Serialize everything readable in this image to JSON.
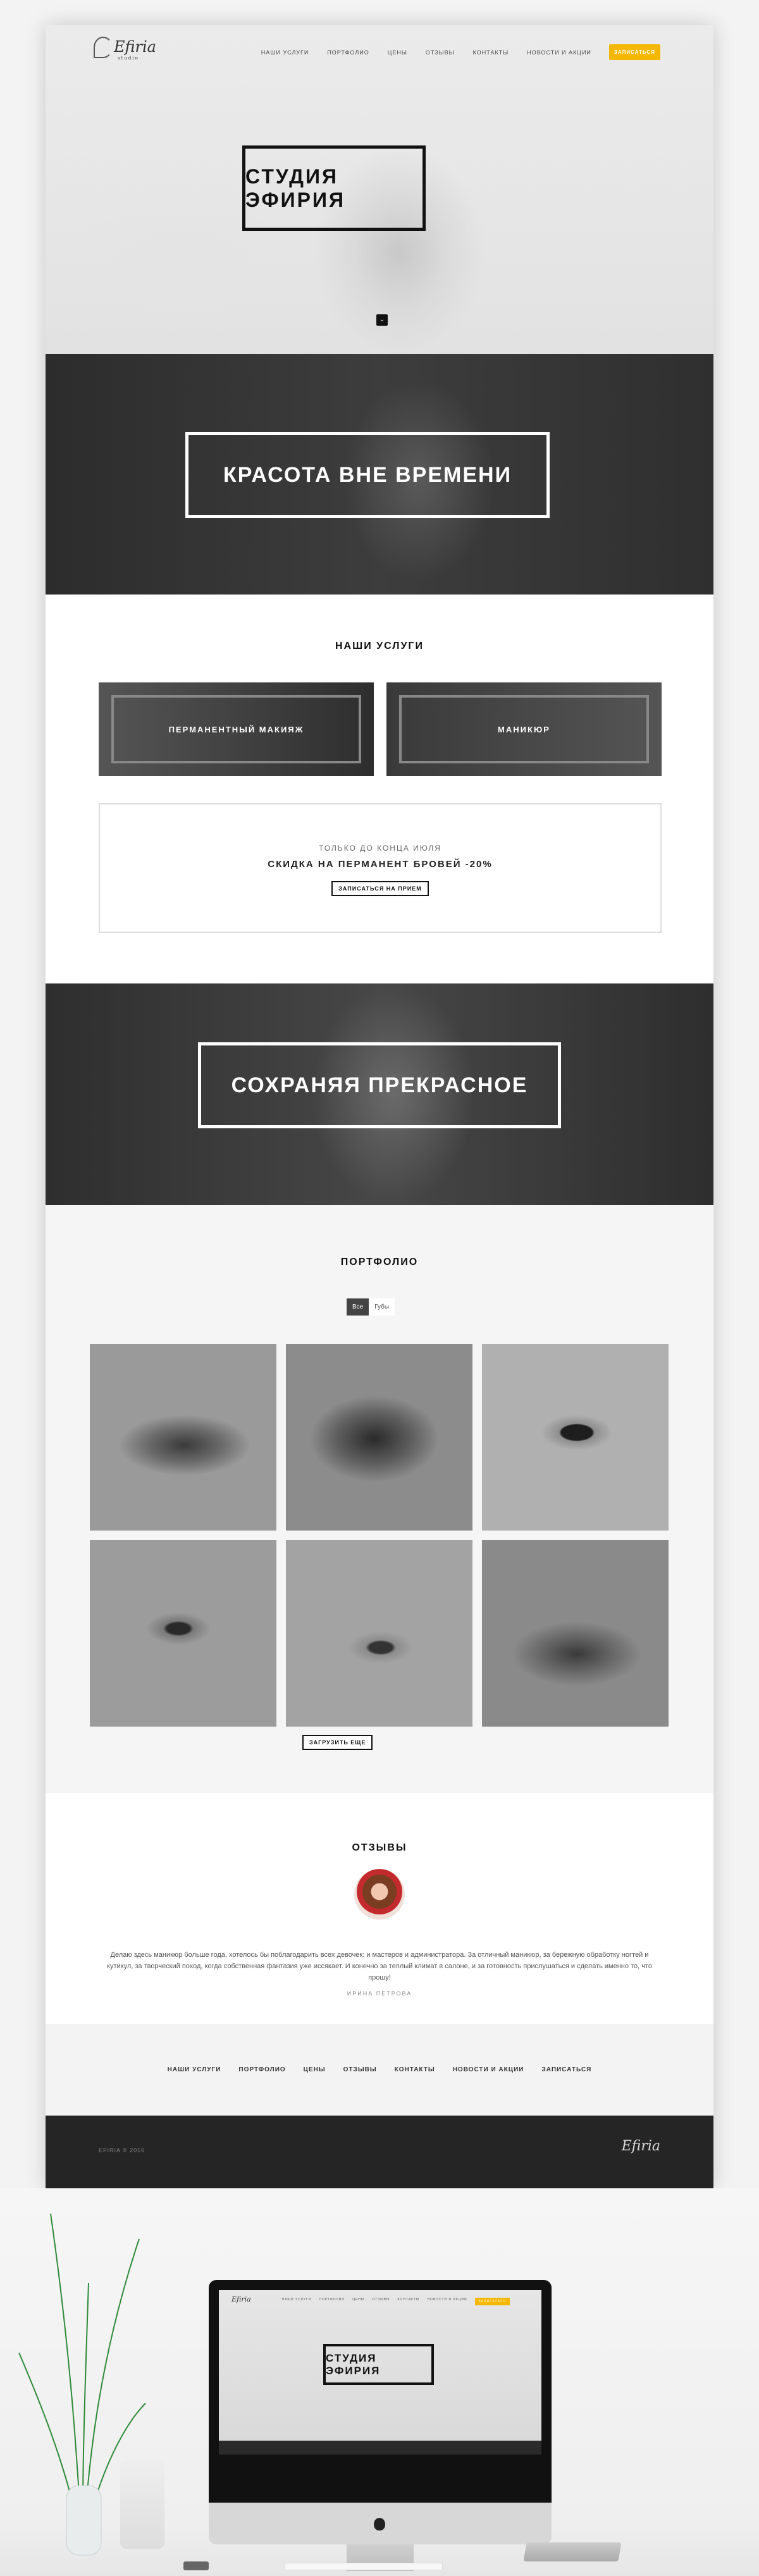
{
  "brand": {
    "logo": "Efiria",
    "logo_sub": "studio"
  },
  "nav": {
    "items": [
      "НАШИ УСЛУГИ",
      "ПОРТФОЛИО",
      "ЦЕНЫ",
      "ОТЗЫВЫ",
      "КОНТАКТЫ",
      "НОВОСТИ И АКЦИИ"
    ],
    "cta": "ЗАПИСАТЬСЯ"
  },
  "hero": {
    "title": "СТУДИЯ ЭФИРИЯ",
    "scroll_icon": "chevron-down-icon"
  },
  "banner1": {
    "title": "КРАСОТА ВНЕ ВРЕМЕНИ"
  },
  "services": {
    "title": "НАШИ УСЛУГИ",
    "items": [
      "ПЕРМАНЕНТНЫЙ МАКИЯЖ",
      "МАНИКЮР"
    ]
  },
  "promo": {
    "line1": "ТОЛЬКО ДО КОНЦА ИЮЛЯ",
    "line2": "СКИДКА НА ПЕРМАНЕНТ БРОВЕЙ -20%",
    "button": "ЗАПИСАТЬСЯ НА ПРИЕМ"
  },
  "banner2": {
    "title": "СОХРАНЯЯ ПРЕКРАСНОЕ"
  },
  "portfolio": {
    "title": "ПОРТФОЛИО",
    "filters": [
      "Все",
      "Губы"
    ],
    "tiles": [
      "губы",
      "губы",
      "глаз",
      "глаз",
      "бровь",
      "губы"
    ],
    "more_button": "ЗАГРУЗИТЬ ЕЩЕ"
  },
  "reviews": {
    "title": "ОТЗЫВЫ",
    "text": "Делаю здесь маникюр больше года, хотелось бы поблагодарить всех девочек: и мастеров и администратора. За отличный маникюр, за бережную обработку ногтей и кутикул, за творческий поход, когда собственная фантазия уже иссякает. И конечно за теплый климат в салоне, и за готовность прислушаться и сделать именно то, что прошу!",
    "author": "ИРИНА ПЕТРОВА"
  },
  "footer": {
    "links": [
      "НАШИ УСЛУГИ",
      "ПОРТФОЛИО",
      "ЦЕНЫ",
      "ОТЗЫВЫ",
      "КОНТАКТЫ",
      "НОВОСТИ И АКЦИИ",
      "ЗАПИСАТЬСЯ"
    ],
    "copyright": "EFIRIA © 2016",
    "logo": "Efiria"
  },
  "mockup": {
    "title": "СТУДИЯ ЭФИРИЯ"
  }
}
